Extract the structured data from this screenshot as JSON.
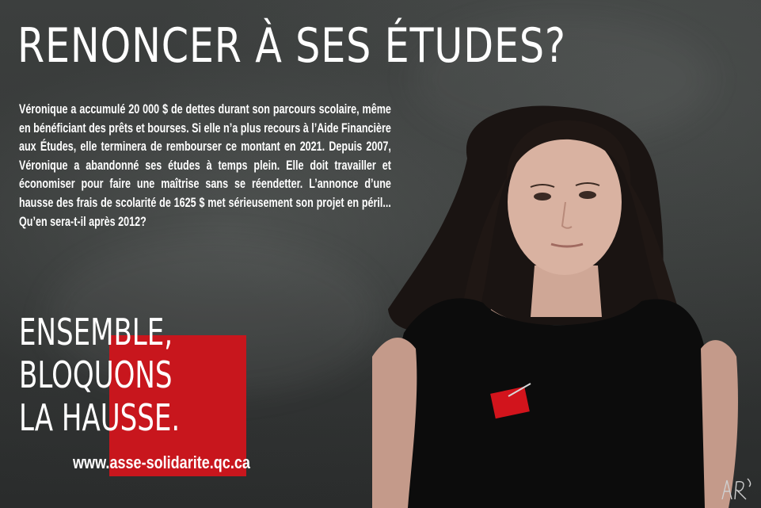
{
  "poster": {
    "headline": "RENONCER À SES ÉTUDES?",
    "body": "Véronique a accumulé 20 000 $ de dettes durant son parcours scolaire, même en bénéficiant des prêts et bourses. Si elle n’a plus recours à l’Aide Financière aux Études, elle terminera de rembourser ce montant en 2021. Depuis 2007, Véronique a abandonné ses études à temps plein. Elle doit travailler et économiser pour faire une maîtrise sans se réendetter. L’annonce d’une hausse des frais de scolarité de 1625 $ met sérieusement son projet en péril... Qu’en sera-t-il après 2012?",
    "slogan": [
      "ENSEMBLE,",
      "BLOQUONS",
      "LA HAUSSE."
    ],
    "url": "www.asse-solidarite.qc.ca"
  },
  "colors": {
    "accent_red": "#c8161d",
    "chalkboard": "#353837",
    "text": "#ffffff"
  },
  "icons": {
    "pin": "red-square-pin-icon",
    "signature": "artist-signature-icon"
  }
}
